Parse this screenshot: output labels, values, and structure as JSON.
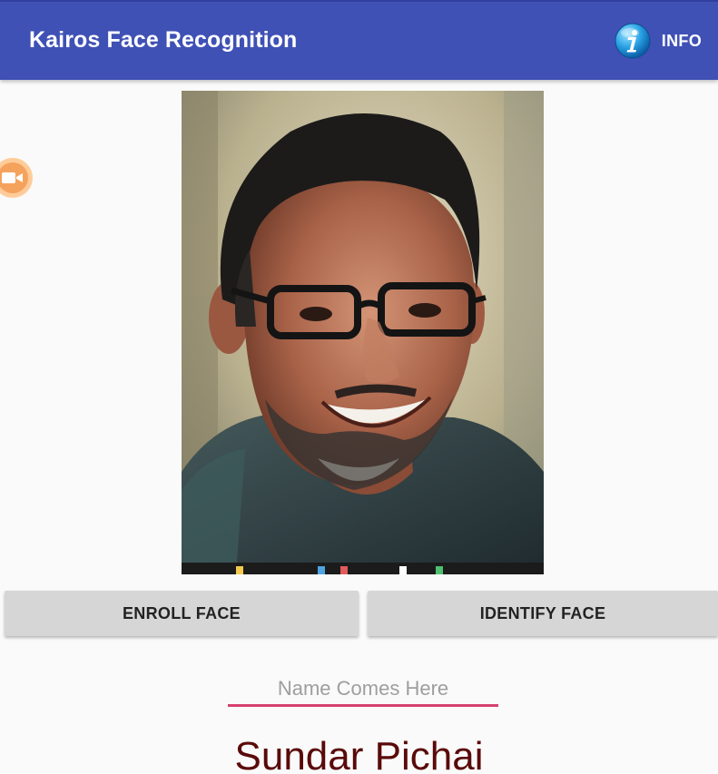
{
  "app": {
    "title": "Kairos Face Recognition",
    "info_label": "INFO"
  },
  "icons": {
    "info": "info-icon",
    "camera": "video-camera-icon"
  },
  "actions": {
    "enroll_label": "ENROLL FACE",
    "identify_label": "IDENTIFY FACE"
  },
  "name_input": {
    "placeholder": "Name Comes Here",
    "value": ""
  },
  "result": {
    "name": "Sundar Pichai"
  },
  "colors": {
    "toolbar": "#3f51b5",
    "button": "#d6d6d6",
    "input_underline": "#d6416f",
    "result_text": "#5a0a0a",
    "camera_bubble": "#f5a25d"
  }
}
